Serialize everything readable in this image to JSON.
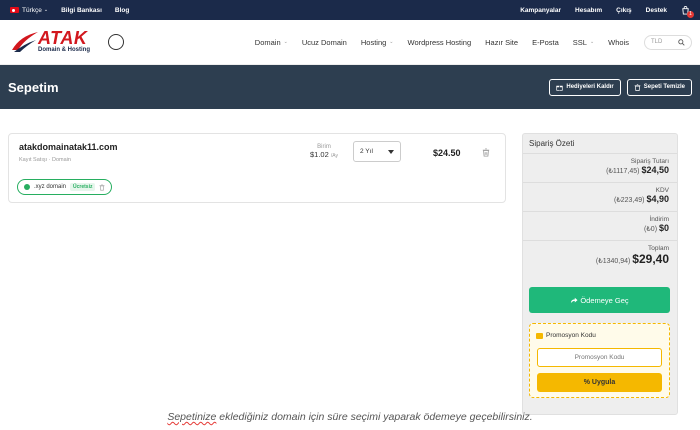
{
  "topbar": {
    "language": "Türkçe",
    "knowledge_base": "Bilgi Bankası",
    "blog": "Blog",
    "campaigns": "Kampanyalar",
    "account": "Hesabım",
    "logout": "Çıkış",
    "support": "Destek",
    "cart_count": "1"
  },
  "logo": {
    "brand": "ATAK",
    "tagline": "Domain & Hosting"
  },
  "nav": {
    "items": [
      "Domain",
      "Ucuz Domain",
      "Hosting",
      "Wordpress Hosting",
      "Hazır Site",
      "E-Posta",
      "SSL",
      "Whois"
    ],
    "tld_placeholder": "TLD"
  },
  "banner": {
    "title": "Sepetim",
    "remove_gifts": "Hediyeleri Kaldır",
    "clear_cart": "Sepeti Temizle"
  },
  "cart_item": {
    "domain": "atakdomainatak11.com",
    "type": "Kayıt Satışı · Domain",
    "unit_label": "Birim",
    "unit_price": "$1.02",
    "unit_period": "/Ay",
    "period_select": "2 Yıl",
    "price": "$24.50",
    "addon_label": ".xyz domain",
    "addon_badge": "Ücretsiz"
  },
  "summary": {
    "title": "Sipariş Özeti",
    "subtotal_label": "Sipariş Tutarı",
    "subtotal_try": "(₺1117,45)",
    "subtotal_usd": "$24,50",
    "tax_label": "KDV",
    "tax_try": "(₺223,49)",
    "tax_usd": "$4,90",
    "discount_label": "İndirim",
    "discount_try": "(₺0)",
    "discount_usd": "$0",
    "total_label": "Toplam",
    "total_try": "(₺1340,94)",
    "total_usd": "$29,40",
    "checkout": "Ödemeye Geç"
  },
  "promo": {
    "title": "Promosyon Kodu",
    "placeholder": "Promosyon Kodu",
    "apply": "% Uygula"
  },
  "caption": {
    "word": "Sepetinize",
    "rest": " eklediğiniz domain için süre seçimi yaparak ödemeye geçebilirsiniz."
  }
}
